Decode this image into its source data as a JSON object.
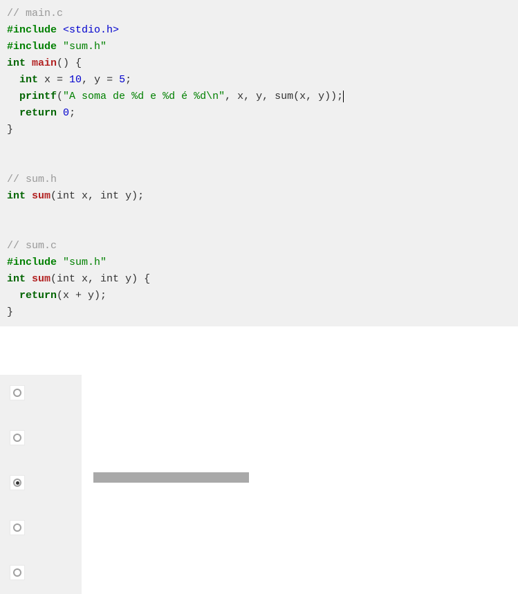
{
  "code": {
    "file1_comment": "// main.c",
    "include1_directive": "#include",
    "include1_file": "<stdio.h>",
    "include2_directive": "#include",
    "include2_file": "\"sum.h\"",
    "main_type": "int",
    "main_name": "main",
    "main_sig_rest": "() {",
    "line_decl_indent": "  ",
    "line_decl_type": "int",
    "line_decl_rest1": " x = ",
    "line_decl_num1": "10",
    "line_decl_mid": ", y = ",
    "line_decl_num2": "5",
    "line_decl_end": ";",
    "printf_indent": "  ",
    "printf_name": "printf",
    "printf_open": "(",
    "printf_str": "\"A soma de %d e %d é %d\\n\"",
    "printf_rest": ", x, y, sum(x, y));",
    "return_indent": "  ",
    "return_kw": "return",
    "return_sp": " ",
    "return_val": "0",
    "return_end": ";",
    "close_brace1": "}",
    "file2_comment": "// sum.h",
    "sumh_type": "int",
    "sumh_name": "sum",
    "sumh_rest": "(int x, int y);",
    "file3_comment": "// sum.c",
    "include3_directive": "#include",
    "include3_file": "\"sum.h\"",
    "sumc_type": "int",
    "sumc_name": "sum",
    "sumc_rest": "(int x, int y) {",
    "sumc_ret_indent": "  ",
    "sumc_ret_kw": "return",
    "sumc_ret_rest": "(x + y);",
    "close_brace2": "}"
  },
  "quiz": {
    "options": [
      {
        "selected": false
      },
      {
        "selected": false
      },
      {
        "selected": true
      },
      {
        "selected": false
      },
      {
        "selected": false
      }
    ]
  }
}
